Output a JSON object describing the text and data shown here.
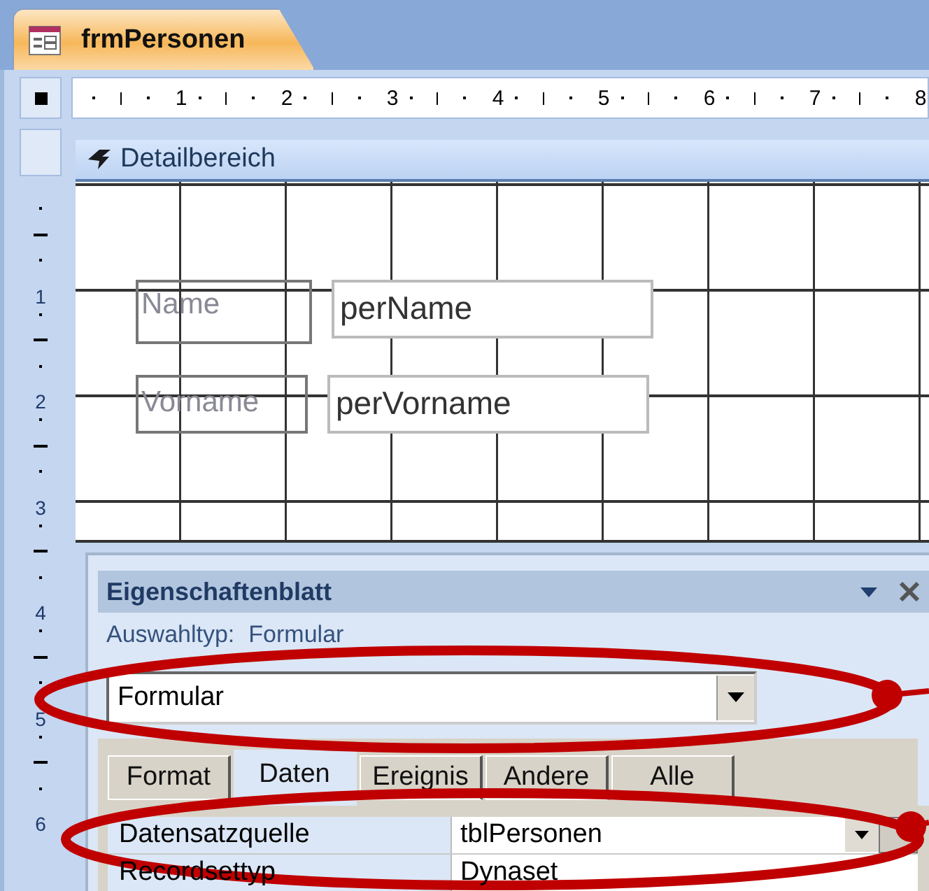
{
  "document_tab": {
    "title": "frmPersonen",
    "selected": true
  },
  "ruler": {
    "horizontal": [
      "1",
      "2",
      "3",
      "4",
      "5",
      "6",
      "7",
      "8"
    ],
    "vertical": [
      "1",
      "2",
      "3",
      "4",
      "5",
      "6"
    ]
  },
  "section": {
    "title": "Detailbereich"
  },
  "form_rows": [
    {
      "label": "Name",
      "field": "perName"
    },
    {
      "label": "Vorname",
      "field": "perVorname"
    }
  ],
  "property_sheet": {
    "title": "Eigenschaftenblatt",
    "selection_type_label": "Auswahltyp:",
    "selection_type": "Formular",
    "object": "Formular",
    "tabs": [
      {
        "label": "Format",
        "selected": false
      },
      {
        "label": "Daten",
        "selected": true
      },
      {
        "label": "Ereignis",
        "selected": false
      },
      {
        "label": "Andere",
        "selected": false
      },
      {
        "label": "Alle",
        "selected": false
      }
    ],
    "properties": [
      {
        "name": "Datensatzquelle",
        "value": "tblPersonen",
        "kind": "dropdown"
      },
      {
        "name": "Recordsettyp",
        "value": "Dynaset",
        "kind": "plain"
      }
    ]
  },
  "callouts": [
    {
      "kind": "ellipse"
    },
    {
      "kind": "ellipse"
    }
  ]
}
